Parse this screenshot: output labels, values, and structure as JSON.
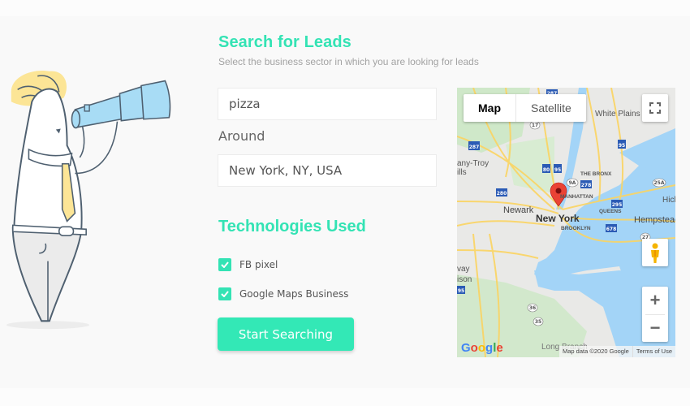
{
  "header": {
    "title": "Search for Leads",
    "subtitle": "Select the business sector in which you are looking for leads"
  },
  "search": {
    "query_value": "pizza",
    "around_label": "Around",
    "location_value": "New York, NY, USA"
  },
  "technologies": {
    "title": "Technologies Used",
    "options": [
      {
        "label": "FB pixel",
        "checked": true
      },
      {
        "label": "Google Maps Business",
        "checked": true
      }
    ]
  },
  "actions": {
    "start_label": "Start Searching"
  },
  "map": {
    "type_options": [
      "Map",
      "Satellite"
    ],
    "active_type": "Map",
    "zoom_in": "+",
    "zoom_out": "−",
    "logo": "Google",
    "attribution": "Map data ©2020 Google",
    "terms": "Terms of Use",
    "marker_location": "New York",
    "labels": {
      "city": "New York",
      "newark": "Newark",
      "hempstead": "Hempstead",
      "white_plains": "White Plains",
      "bronx": "THE BRONX",
      "manhattan": "MANHATTAN",
      "queens": "QUEENS",
      "brooklyn": "BROOKLYN",
      "troy": "any-Troy",
      "hills": "ills",
      "hick": "Hick",
      "way": "vay",
      "ison": "ison",
      "long_branch": "Long Branch"
    },
    "route_shields": [
      "287",
      "287",
      "80",
      "95",
      "95",
      "280",
      "278",
      "295",
      "678",
      "9A",
      "17",
      "25A",
      "27",
      "36",
      "35",
      "95"
    ]
  },
  "colors": {
    "accent": "#33e3b4",
    "background": "#f9f9f9"
  }
}
